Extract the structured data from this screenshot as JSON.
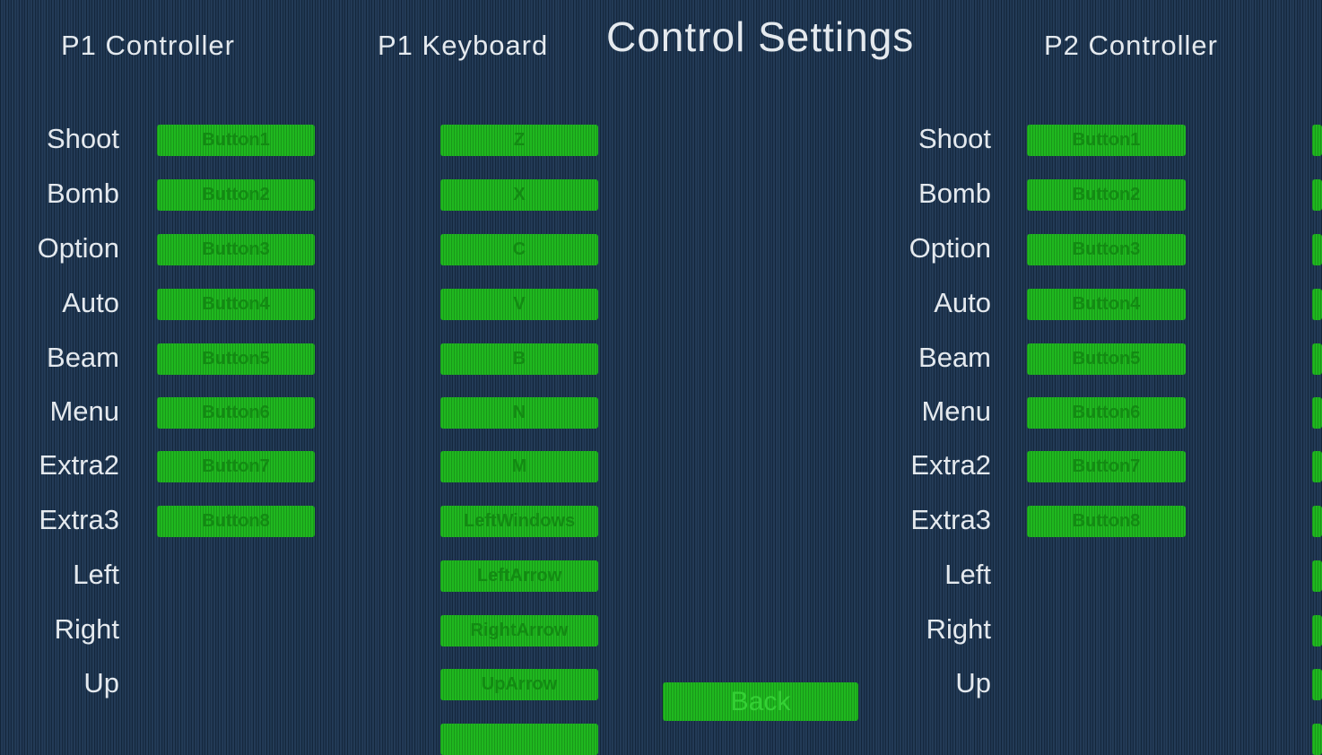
{
  "screen_title": "Control Settings",
  "columns": {
    "p1_controller": "P1 Controller",
    "p1_keyboard": "P1 Keyboard",
    "p2_controller": "P2 Controller"
  },
  "actions": [
    "Shoot",
    "Bomb",
    "Option",
    "Auto",
    "Beam",
    "Menu",
    "Extra2",
    "Extra3",
    "Left",
    "Right",
    "Up"
  ],
  "p1_controller_bindings": [
    "Button1",
    "Button2",
    "Button3",
    "Button4",
    "Button5",
    "Button6",
    "Button7",
    "Button8"
  ],
  "p1_keyboard_bindings": [
    "Z",
    "X",
    "C",
    "V",
    "B",
    "N",
    "M",
    "LeftWindows",
    "LeftArrow",
    "RightArrow",
    "UpArrow",
    ""
  ],
  "p2_controller_bindings": [
    "Button1",
    "Button2",
    "Button3",
    "Button4",
    "Button5",
    "Button6",
    "Button7",
    "Button8"
  ],
  "p2_keyboard_bindings": [
    "",
    "",
    "",
    "",
    "",
    "",
    "",
    "",
    "",
    "",
    "",
    ""
  ],
  "back_label": "Back",
  "colors": {
    "background": "#1a3350",
    "button_green": "#1fb81f",
    "button_text": "#138a13",
    "text": "#e4e9ee"
  }
}
